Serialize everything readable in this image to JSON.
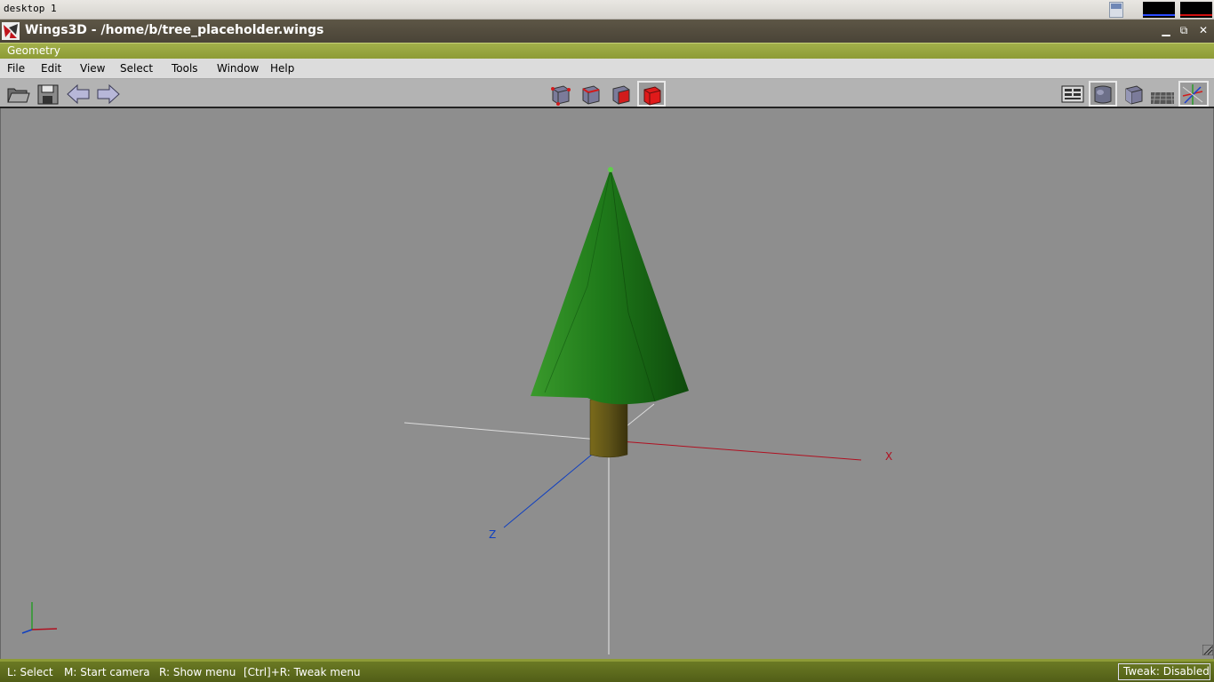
{
  "desktop": {
    "label": "desktop 1"
  },
  "window": {
    "title": "Wings3D - /home/b/tree_placeholder.wings",
    "minimize": "▁",
    "maximize": "⧉",
    "close": "✕"
  },
  "geometry_bar": {
    "label": "Geometry"
  },
  "menu": {
    "items": [
      "File",
      "Edit",
      "View",
      "Select",
      "Tools",
      "Window",
      "Help"
    ]
  },
  "toolbar": {
    "left": [
      "open-folder-icon",
      "save-disk-icon",
      "undo-arrow-icon",
      "redo-arrow-icon"
    ],
    "selection_modes": [
      "vertex-select-icon",
      "edge-select-icon",
      "face-select-icon",
      "body-select-icon"
    ],
    "active_selection_mode": "body-select-icon",
    "right": [
      "workmode-icon",
      "smooth-shaded-icon",
      "flat-shaded-icon",
      "ground-plane-icon",
      "show-axes-icon"
    ]
  },
  "viewport": {
    "axis_labels": {
      "x": "X",
      "z": "Z"
    },
    "colors": {
      "background": "#8e8e8e",
      "foliage": "#1f7a1a",
      "trunk": "#5e5318",
      "x_axis": "#b01020",
      "z_axis": "#1040c0",
      "y_axis": "#e8e8e8"
    }
  },
  "status": {
    "hints": [
      "L: Select",
      "M: Start camera",
      "R: Show menu",
      "[Ctrl]+R: Tweak menu"
    ],
    "tweak": "Tweak: Disabled"
  }
}
